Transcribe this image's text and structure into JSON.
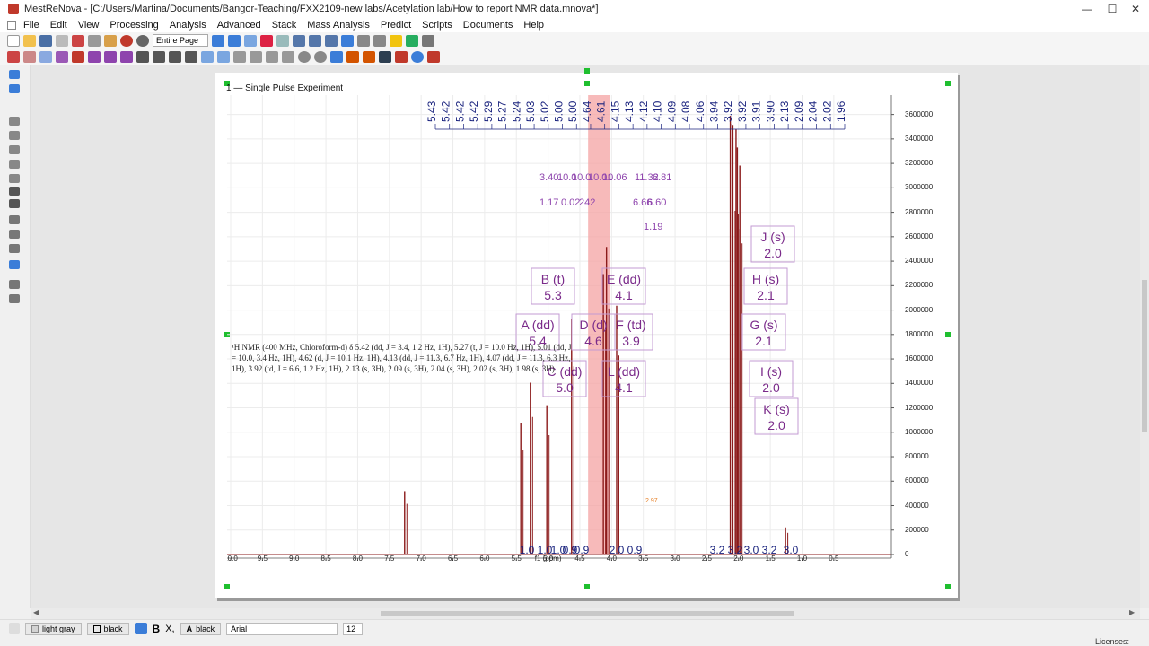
{
  "window": {
    "title": "MestReNova - [C:/Users/Martina/Documents/Bangor-Teaching/FXX2109-new labs/Acetylation lab/How to report NMR data.mnova*]",
    "minimize": "—",
    "maximize": "☐",
    "close": "✕"
  },
  "menu": {
    "items": [
      "File",
      "Edit",
      "View",
      "Processing",
      "Analysis",
      "Advanced",
      "Stack",
      "Mass Analysis",
      "Predict",
      "Scripts",
      "Documents",
      "Help"
    ]
  },
  "toolbar": {
    "page_select": "Entire Page"
  },
  "document": {
    "experiment_title": "1 — Single Pulse Experiment",
    "report_text": "¹H NMR (400 MHz, Chloroform-d) δ 5.42 (dd, J = 3.4, 1.2 Hz, 1H), 5.27 (t, J = 10.0 Hz, 1H), 5.01 (dd, J = 10.0, 3.4 Hz, 1H), 4.62 (d, J = 10.1 Hz, 1H), 4.13 (dd, J = 11.3, 6.7 Hz, 1H), 4.07 (dd, J = 11.3, 6.3 Hz, 1H), 3.92 (td, J = 6.6, 1.2 Hz, 1H), 2.13 (s, 3H), 2.09 (s, 3H), 2.04 (s, 3H), 2.02 (s, 3H), 1.98 (s, 3H)."
  },
  "chart_data": {
    "type": "line",
    "xlabel": "f1 (ppm)",
    "x_ticks": [
      "10.0",
      "9.5",
      "9.0",
      "8.5",
      "8.0",
      "7.5",
      "7.0",
      "6.5",
      "6.0",
      "5.5",
      "5.0",
      "4.5",
      "4.0",
      "3.5",
      "3.0",
      "2.5",
      "2.0",
      "1.5",
      "1.0",
      "0.5"
    ],
    "x_range": [
      10.0,
      0.3
    ],
    "y_ticks": [
      "3600000",
      "3400000",
      "3200000",
      "3000000",
      "2800000",
      "2600000",
      "2400000",
      "2200000",
      "2000000",
      "1800000",
      "1600000",
      "1400000",
      "1200000",
      "1000000",
      "800000",
      "600000",
      "400000",
      "200000",
      "0"
    ],
    "y_range": [
      0,
      3700000
    ],
    "highlight_ppm": [
      4.03,
      4.37
    ],
    "peak_labels_top": [
      "5.43",
      "5.42",
      "5.42",
      "5.42",
      "5.29",
      "5.27",
      "5.24",
      "5.03",
      "5.02",
      "5.00",
      "5.00",
      "4.64",
      "4.61",
      "4.15",
      "4.13",
      "4.12",
      "4.10",
      "4.09",
      "4.08",
      "4.06",
      "3.94",
      "3.92",
      "3.92",
      "3.91",
      "3.90",
      "2.13",
      "2.09",
      "2.04",
      "2.02",
      "1.96"
    ],
    "coupling_fragments": [
      "3.40",
      "10.0",
      "10.0",
      "10.01",
      "10.06",
      "11.32",
      "6.81",
      "1.17",
      "0.02",
      "242",
      "6.66",
      "6.60",
      "1.19"
    ],
    "multiplets": [
      {
        "label": "A (dd)",
        "shift": "5.4"
      },
      {
        "label": "B (t)",
        "shift": "5.3"
      },
      {
        "label": "C (dd)",
        "shift": "5.0"
      },
      {
        "label": "D (d)",
        "shift": "4.6"
      },
      {
        "label": "E (dd)",
        "shift": "4.1"
      },
      {
        "label": "F (td)",
        "shift": "3.9"
      },
      {
        "label": "L (dd)",
        "shift": "4.1"
      },
      {
        "label": "J (s)",
        "shift": "2.0"
      },
      {
        "label": "H (s)",
        "shift": "2.1"
      },
      {
        "label": "G (s)",
        "shift": "2.1"
      },
      {
        "label": "I (s)",
        "shift": "2.0"
      },
      {
        "label": "K (s)",
        "shift": "2.0"
      }
    ],
    "integrals": [
      "1.0",
      "1.0",
      "1.0",
      "0.9",
      "0.9",
      "2.0",
      "0.9",
      "3.2",
      "3.2",
      "3.0",
      "3.2",
      "3.0"
    ],
    "integral_annotations": [
      "2.97"
    ],
    "peaks": [
      {
        "ppm": 7.26,
        "h": 0.14
      },
      {
        "ppm": 5.43,
        "h": 0.29
      },
      {
        "ppm": 5.28,
        "h": 0.38
      },
      {
        "ppm": 5.02,
        "h": 0.33
      },
      {
        "ppm": 4.63,
        "h": 0.52
      },
      {
        "ppm": 4.13,
        "h": 0.62
      },
      {
        "ppm": 4.08,
        "h": 0.68
      },
      {
        "ppm": 3.92,
        "h": 0.55
      },
      {
        "ppm": 2.13,
        "h": 0.97
      },
      {
        "ppm": 2.09,
        "h": 0.95
      },
      {
        "ppm": 2.04,
        "h": 0.94
      },
      {
        "ppm": 2.02,
        "h": 0.9
      },
      {
        "ppm": 1.98,
        "h": 0.86
      },
      {
        "ppm": 1.26,
        "h": 0.06
      }
    ],
    "colors": {
      "trace": "#8b1a1a",
      "highlight": "#f4a3a3",
      "label": "#7a2a8a",
      "integral": "#1a237e"
    }
  },
  "statusbar": {
    "fill_label": "light gray",
    "line_label": "black",
    "bold": "B",
    "x_label": "X,",
    "font_color": "black",
    "font_name": "Arial",
    "font_size": "12",
    "licenses": "Licenses:"
  }
}
